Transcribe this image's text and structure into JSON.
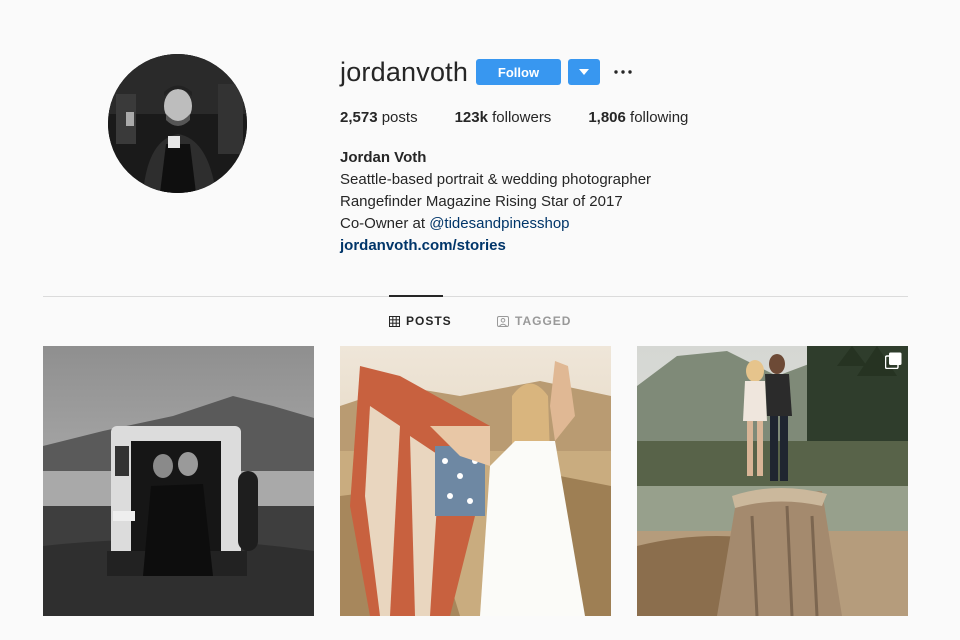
{
  "profile": {
    "username": "jordanvoth",
    "follow_label": "Follow",
    "stats": [
      {
        "value": "2,573",
        "label": "posts"
      },
      {
        "value": "123k",
        "label": "followers"
      },
      {
        "value": "1,806",
        "label": "following"
      }
    ],
    "bio": {
      "name": "Jordan Voth",
      "line1": "Seattle-based portrait & wedding photographer",
      "line2": "Rangefinder Magazine Rising Star of 2017",
      "line3_prefix": "Co-Owner at ",
      "line3_mention": "@tidesandpinesshop",
      "website": "jordanvoth.com/stories"
    }
  },
  "tabs": [
    {
      "label": "POSTS",
      "icon": "grid-icon",
      "active": true
    },
    {
      "label": "TAGGED",
      "icon": "tag-icon",
      "active": false
    }
  ],
  "colors": {
    "accent": "#3897f0",
    "link": "#003569",
    "background": "#fafafa",
    "text": "#262626"
  },
  "posts": [
    {
      "description": "black-and-white photo of couple sitting in back of vehicle"
    },
    {
      "description": "woman in white dress holding american flag"
    },
    {
      "description": "couple kissing on tree stump by lake",
      "multi": true
    }
  ]
}
